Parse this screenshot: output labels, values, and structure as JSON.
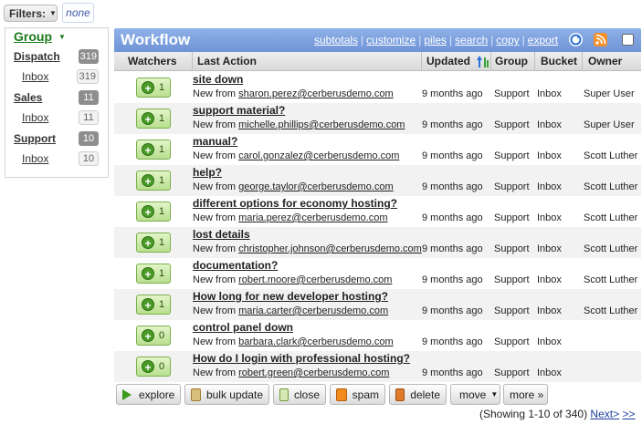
{
  "filters": {
    "label": "Filters:",
    "none_label": "none"
  },
  "sidebar": {
    "title": "Group",
    "items": [
      {
        "label": "Dispatch",
        "count": "319",
        "kind": "group"
      },
      {
        "label": "Inbox",
        "count": "319",
        "kind": "bucket"
      },
      {
        "label": "Sales",
        "count": "11",
        "kind": "group"
      },
      {
        "label": "Inbox",
        "count": "11",
        "kind": "bucket"
      },
      {
        "label": "Support",
        "count": "10",
        "kind": "group"
      },
      {
        "label": "Inbox",
        "count": "10",
        "kind": "bucket"
      }
    ]
  },
  "workflow": {
    "title": "Workflow",
    "links": [
      "subtotals",
      "customize",
      "piles",
      "search",
      "copy",
      "export"
    ],
    "columns": [
      "Watchers",
      "Last Action",
      "Updated",
      "Group",
      "Bucket",
      "Owner"
    ],
    "new_from_label": "New from",
    "rows": [
      {
        "watchers": "1",
        "subject": "site down",
        "email": "sharon.perez@cerberusdemo.com",
        "updated": "9 months ago",
        "group": "Support",
        "bucket": "Inbox",
        "owner": "Super User"
      },
      {
        "watchers": "1",
        "subject": "support material?",
        "email": "michelle.phillips@cerberusdemo.com",
        "updated": "9 months ago",
        "group": "Support",
        "bucket": "Inbox",
        "owner": "Super User"
      },
      {
        "watchers": "1",
        "subject": "manual?",
        "email": "carol.gonzalez@cerberusdemo.com",
        "updated": "9 months ago",
        "group": "Support",
        "bucket": "Inbox",
        "owner": "Scott Luther"
      },
      {
        "watchers": "1",
        "subject": "help?",
        "email": "george.taylor@cerberusdemo.com",
        "updated": "9 months ago",
        "group": "Support",
        "bucket": "Inbox",
        "owner": "Scott Luther"
      },
      {
        "watchers": "1",
        "subject": "different options for economy hosting?",
        "email": "maria.perez@cerberusdemo.com",
        "updated": "9 months ago",
        "group": "Support",
        "bucket": "Inbox",
        "owner": "Scott Luther"
      },
      {
        "watchers": "1",
        "subject": "lost details",
        "email": "christopher.johnson@cerberusdemo.com",
        "updated": "9 months ago",
        "group": "Support",
        "bucket": "Inbox",
        "owner": "Scott Luther"
      },
      {
        "watchers": "1",
        "subject": "documentation?",
        "email": "robert.moore@cerberusdemo.com",
        "updated": "9 months ago",
        "group": "Support",
        "bucket": "Inbox",
        "owner": "Scott Luther"
      },
      {
        "watchers": "1",
        "subject": "How long for new developer hosting?",
        "email": "maria.carter@cerberusdemo.com",
        "updated": "9 months ago",
        "group": "Support",
        "bucket": "Inbox",
        "owner": "Scott Luther"
      },
      {
        "watchers": "0",
        "subject": "control panel down",
        "email": "barbara.clark@cerberusdemo.com",
        "updated": "9 months ago",
        "group": "Support",
        "bucket": "Inbox",
        "owner": ""
      },
      {
        "watchers": "0",
        "subject": "How do I login with professional hosting?",
        "email": "robert.green@cerberusdemo.com",
        "updated": "9 months ago",
        "group": "Support",
        "bucket": "Inbox",
        "owner": ""
      }
    ]
  },
  "toolbar": {
    "explore": "explore",
    "bulk_update": "bulk update",
    "close": "close",
    "spam": "spam",
    "delete": "delete",
    "move": "move",
    "more": "more »"
  },
  "pagination": {
    "showing": "(Showing 1-10 of 340)",
    "next": "Next>",
    "last": ">>"
  },
  "icons": {
    "filters_caret": "chevron-down-icon",
    "refresh": "refresh-icon",
    "rss": "rss-icon",
    "sort": "sort-ascending-icon",
    "watch": "plus-icon"
  }
}
